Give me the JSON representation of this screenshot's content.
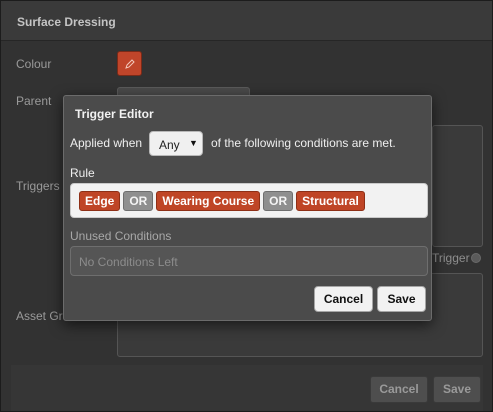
{
  "background": {
    "title": "Surface Dressing",
    "labels": {
      "colour": "Colour",
      "parent": "Parent",
      "triggers": "Triggers",
      "asset_groups": "Asset Gro"
    },
    "add_trigger": "Trigger",
    "colour_value": "#c0452a",
    "buttons": {
      "cancel": "Cancel",
      "save": "Save"
    }
  },
  "trigger_editor": {
    "title": "Trigger Editor",
    "applied_prefix": "Applied when",
    "match_select": {
      "value": "Any",
      "icon": "caret-down-icon"
    },
    "applied_suffix": "of the following conditions are met.",
    "rule_label": "Rule",
    "rule_items": [
      {
        "kind": "condition",
        "text": "Edge"
      },
      {
        "kind": "operator",
        "text": "OR"
      },
      {
        "kind": "condition",
        "text": "Wearing Course"
      },
      {
        "kind": "operator",
        "text": "OR"
      },
      {
        "kind": "condition",
        "text": "Structural"
      }
    ],
    "unused_label": "Unused Conditions",
    "unused_placeholder": "No Conditions Left",
    "buttons": {
      "cancel": "Cancel",
      "save": "Save"
    }
  },
  "colors": {
    "condition_chip": "#bf4526",
    "operator_chip": "#8f8f8f",
    "modal_bg": "#4b4b4b"
  }
}
